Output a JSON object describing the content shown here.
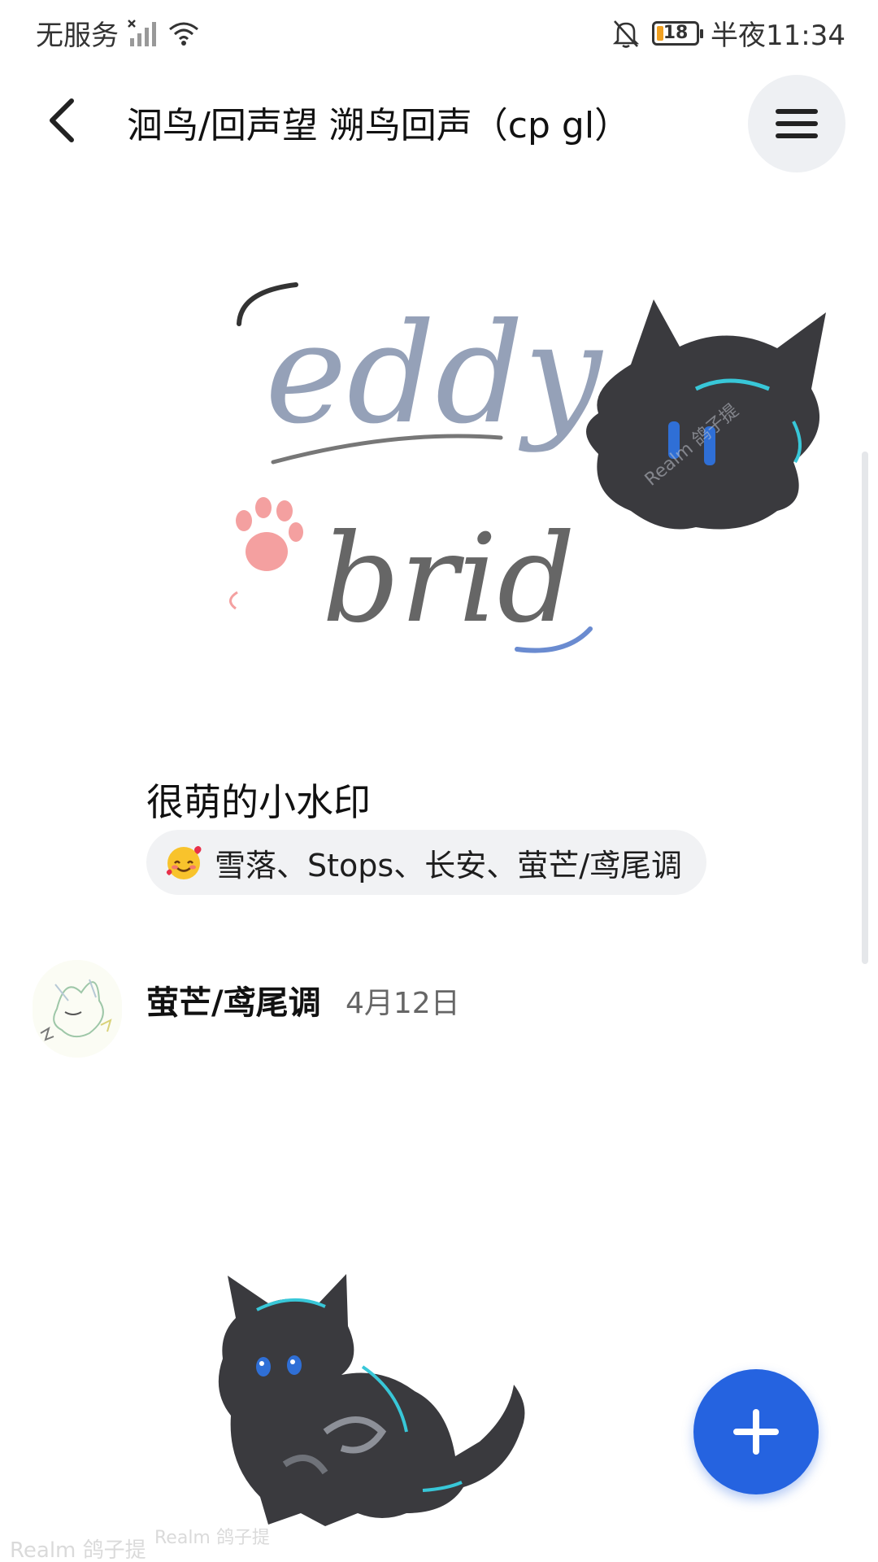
{
  "status_bar": {
    "carrier": "无服务",
    "battery_level": "18",
    "time": "半夜11:34"
  },
  "header": {
    "title": "洄鸟/回声望 溯鸟回声（cp gl）"
  },
  "post": {
    "caption": "很萌的小水印",
    "reaction_names": "雪落、Stops、长安、萤芒/鸢尾调",
    "reaction_emoji": "smiling-face-with-hearts"
  },
  "author_post": {
    "author": "萤芒/鸢尾调",
    "date": "4月12日"
  },
  "artwork": {
    "watermark_text_line1": "eddy",
    "watermark_text_line2": "brid",
    "credit_text": "Realm 鸽子提"
  },
  "colors": {
    "accent": "#2563e0",
    "paw": "#f4a0a0",
    "cat_body": "#3a3a3e",
    "cat_eye": "#2f6fd6",
    "cat_stripe": "#38c7d8"
  }
}
